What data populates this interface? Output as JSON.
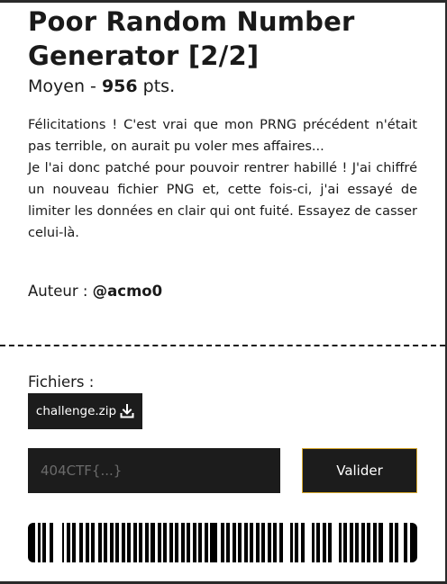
{
  "challenge": {
    "title": "Poor Random Number Generator [2/2]",
    "difficulty": "Moyen",
    "separator": "-",
    "points": "956",
    "points_unit": "pts.",
    "description": [
      "Félicitations ! C'est vrai que mon PRNG précédent n'était pas terrible, on aurait pu voler mes affaires...",
      "Je l'ai donc patché pour pouvoir rentrer habillé ! J'ai chiffré un nouveau fichier PNG et, cette fois-ci, j'ai essayé de limiter les données en clair qui ont fuité. Essayez de casser celui-là."
    ],
    "author_label": "Auteur :",
    "author_name": "@acmo0"
  },
  "files": {
    "label": "Fichiers :",
    "items": [
      {
        "name": "challenge.zip",
        "icon": "download-icon"
      }
    ]
  },
  "flag_form": {
    "placeholder": "404CTF{...}",
    "value": "",
    "submit_label": "Valider"
  },
  "colors": {
    "card_background": "#ffffff",
    "dark": "#1c1c1c",
    "submit_border": "#d4a52a",
    "page_background": "#2a2a2a"
  }
}
